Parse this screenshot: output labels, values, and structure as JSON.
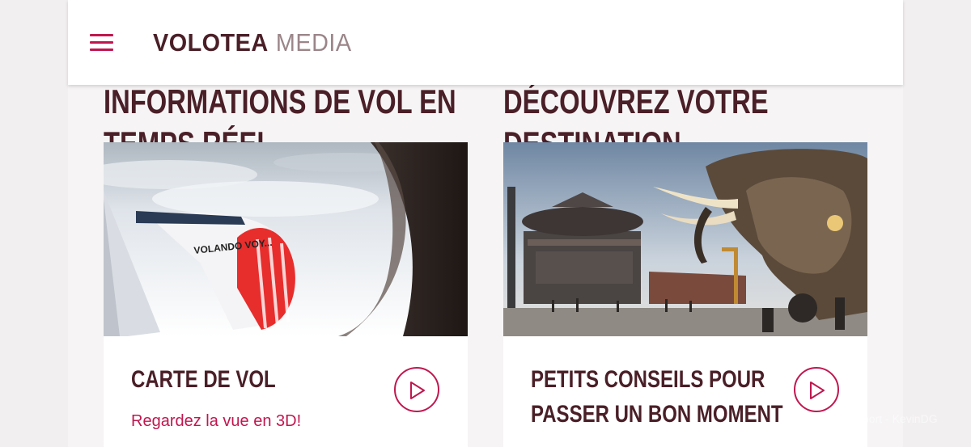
{
  "header": {
    "logo_brand": "VOLOTEA",
    "logo_media": "MEDIA",
    "menu_icon": "hamburger-menu-icon"
  },
  "sections": [
    {
      "title": "INFORMATIONS DE VOL EN TEMPS RÉEL"
    },
    {
      "title": "DÉCOUVREZ VOTRE DESTINATION"
    }
  ],
  "cards": [
    {
      "title": "CARTE DE VOL",
      "subtitle": "Regardez la vue en 3D!",
      "image_text": "VOLANDO VOY...",
      "icon": "play-icon"
    },
    {
      "title": "PETITS CONSEILS POUR PASSER UN BON MOMENT",
      "subtitle": "",
      "icon": "play-icon"
    }
  ],
  "watermark": "port - KevinDG",
  "colors": {
    "brand": "#4a1f27",
    "accent": "#c0174f",
    "background": "#f6f4f5"
  }
}
